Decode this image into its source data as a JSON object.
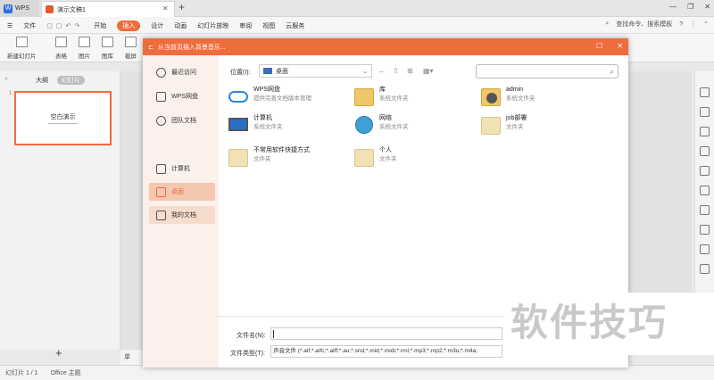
{
  "titlebar": {
    "app_tab": "WPS",
    "doc_tab": "演示文稿1"
  },
  "menu": {
    "items": [
      "文件",
      "开始",
      "插入",
      "设计",
      "动画",
      "幻灯片放映",
      "审阅",
      "视图",
      "云服务"
    ],
    "active": "插入",
    "search_placeholder": "查找命令、搜索模板"
  },
  "ribbon": {
    "items": [
      "新建幻灯片",
      "表格",
      "图片",
      "图库",
      "截屏"
    ]
  },
  "left_panel": {
    "tab_outline": "大纲",
    "tab_slides": "幻灯片",
    "slide_number": "1",
    "slide_title": "空白演示"
  },
  "statusbar": {
    "slide_info": "幻灯片 1 / 1",
    "theme": "Office 主题"
  },
  "notes": {
    "label": "单"
  },
  "dialog": {
    "title": "从当前页插入背景音乐...",
    "sidebar": [
      "最近访问",
      "WPS网盘",
      "团队文档",
      "计算机",
      "桌面",
      "我的文档"
    ],
    "location_label": "位置(I):",
    "location_value": "桌面",
    "files": [
      {
        "name": "WPS网盘",
        "sub": "提供完善文档版本管理",
        "icon": "cloud-icon"
      },
      {
        "name": "库",
        "sub": "系统文件夹",
        "icon": "library-folder-icon"
      },
      {
        "name": "admin",
        "sub": "系统文件夹",
        "icon": "user-folder-icon"
      },
      {
        "name": "计算机",
        "sub": "系统文件夹",
        "icon": "computer-icon"
      },
      {
        "name": "网络",
        "sub": "系统文件夹",
        "icon": "network-icon"
      },
      {
        "name": "job部署",
        "sub": "文件夹",
        "icon": "folder-icon"
      },
      {
        "name": "不常用软件快捷方式",
        "sub": "文件夹",
        "icon": "folder-icon"
      },
      {
        "name": "个人",
        "sub": "文件夹",
        "icon": "folder-icon"
      }
    ],
    "filename_label": "文件名(N):",
    "filename_value": "",
    "filetype_label": "文件类型(T):",
    "filetype_value": "声音文件 (*.aif;*.aifc;*.aiff;*.au;*.snd;*.mid;*.midi;*.rmi;*.mp3;*.mp2;*.m3u;*.m4a;"
  },
  "watermark": "软件技巧"
}
